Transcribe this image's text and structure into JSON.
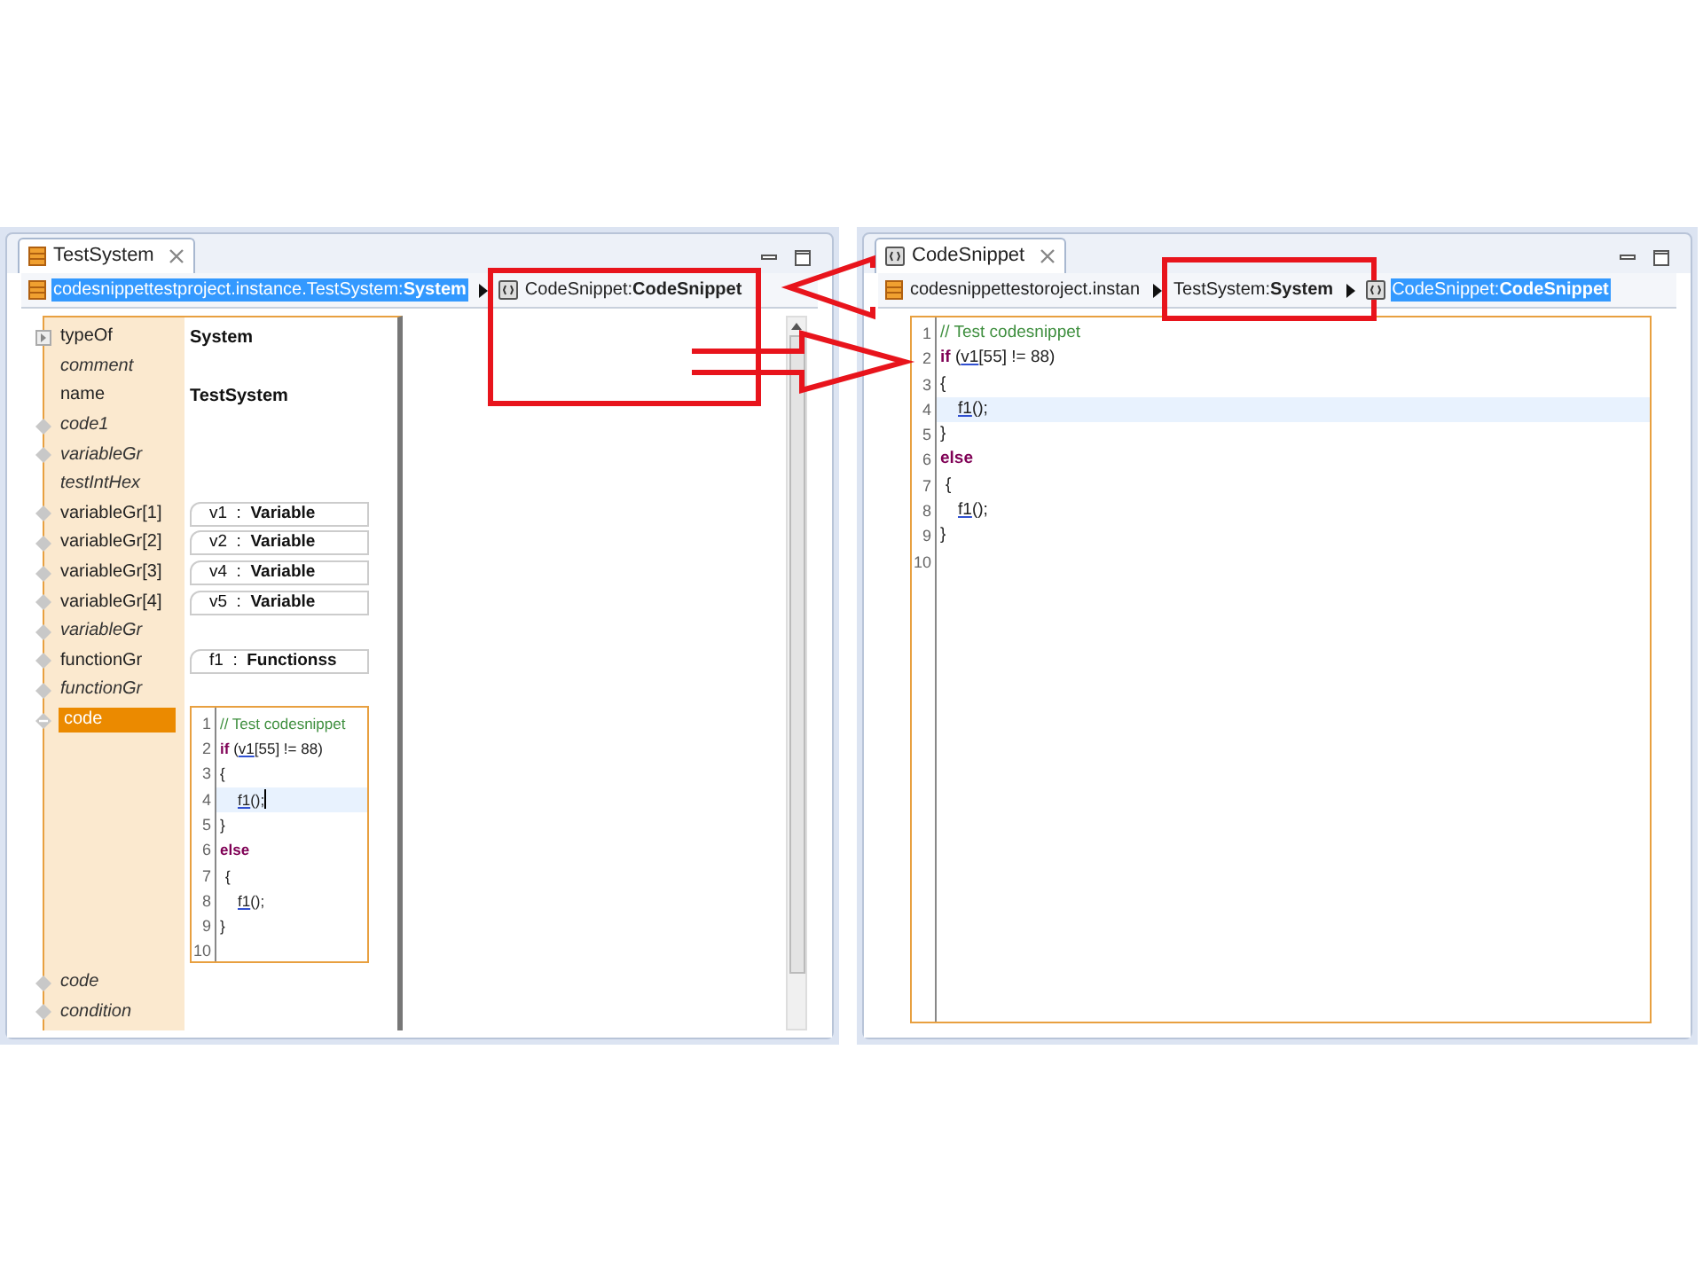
{
  "left_editor": {
    "tab": {
      "title": "TestSystem",
      "selected": true
    },
    "breadcrumb": [
      {
        "text": "codesnippettestproject.instance.TestSystem:",
        "bold": "System",
        "selected": true
      },
      {
        "text": "CodeSnippet:",
        "bold": "CodeSnippet",
        "selected": false
      }
    ],
    "properties": [
      {
        "label": "typeOf",
        "italic": false,
        "kind": "type",
        "value": "System",
        "selected": false
      },
      {
        "label": "comment",
        "italic": true,
        "kind": "attribute",
        "selected": false
      },
      {
        "label": "name",
        "italic": false,
        "kind": "attribute",
        "value": "TestSystem",
        "selected": false
      },
      {
        "label": "code1",
        "italic": true,
        "kind": "feature",
        "selected": false
      },
      {
        "label": "variableGr",
        "italic": true,
        "kind": "feature",
        "selected": false
      },
      {
        "label": "testIntHex",
        "italic": true,
        "kind": "attribute",
        "selected": false
      },
      {
        "label": "variableGr[1]",
        "italic": false,
        "kind": "reference",
        "value": "v1  :  **Variable**",
        "selected": false
      },
      {
        "label": "variableGr[2]",
        "italic": false,
        "kind": "reference",
        "value": "v2  :  **Variable**",
        "selected": false
      },
      {
        "label": "variableGr[3]",
        "italic": false,
        "kind": "reference",
        "value": "v4  :  **Variable**",
        "selected": false
      },
      {
        "label": "variableGr[4]",
        "italic": false,
        "kind": "reference",
        "value": "v5  :  **Variable**",
        "selected": false
      },
      {
        "label": "variableGr",
        "italic": true,
        "kind": "feature",
        "selected": false
      },
      {
        "label": "functionGr",
        "italic": false,
        "kind": "reference",
        "value": "f1  :  **Functionss**",
        "selected": false
      },
      {
        "label": "functionGr",
        "italic": true,
        "kind": "feature",
        "selected": false
      },
      {
        "label": "code",
        "italic": false,
        "kind": "code",
        "selected": true,
        "lines": [
          {
            "number": "1",
            "current": false,
            "kind": "flush",
            "segments": [
              {
                "kind": "comment",
                "text": "// Test codesnippet"
              }
            ]
          },
          {
            "number": "2",
            "current": false,
            "kind": "flush",
            "segments": [
              {
                "kind": "keyword",
                "text": "if"
              },
              {
                "kind": "plain",
                "text": " ("
              },
              {
                "kind": "ref",
                "text": "v1"
              },
              {
                "kind": "plain",
                "text": "[55] != 88)"
              }
            ]
          },
          {
            "number": "3",
            "current": false,
            "kind": "flush",
            "segments": [
              {
                "kind": "plain",
                "text": "{"
              }
            ]
          },
          {
            "number": "4",
            "current": true,
            "kind": "nested",
            "segments": [
              {
                "kind": "ref",
                "text": "f1"
              },
              {
                "kind": "plain",
                "text": "();"
              }
            ]
          },
          {
            "number": "5",
            "current": false,
            "kind": "flush",
            "segments": [
              {
                "kind": "plain",
                "text": "}"
              }
            ]
          },
          {
            "number": "6",
            "current": false,
            "kind": "flush",
            "segments": [
              {
                "kind": "keyword",
                "text": "else"
              }
            ]
          },
          {
            "number": "7",
            "current": false,
            "kind": "offset",
            "segments": [
              {
                "kind": "plain",
                "text": "{"
              }
            ]
          },
          {
            "number": "8",
            "current": false,
            "kind": "nested",
            "segments": [
              {
                "kind": "ref",
                "text": "f1"
              },
              {
                "kind": "plain",
                "text": "();"
              }
            ]
          },
          {
            "number": "9",
            "current": false,
            "kind": "flush",
            "segments": [
              {
                "kind": "plain",
                "text": "}"
              }
            ]
          },
          {
            "number": "10",
            "current": false,
            "kind": "flush"
          }
        ]
      },
      {
        "label": "code",
        "italic": true,
        "kind": "feature",
        "selected": false
      },
      {
        "label": "condition",
        "italic": true,
        "kind": "feature",
        "selected": false
      }
    ]
  },
  "right_editor": {
    "tab": {
      "title": "CodeSnippet",
      "selected": true
    },
    "breadcrumb": [
      {
        "text": "codesnippettestoroject.instan",
        "selected": false
      },
      {
        "text": "TestSystem:",
        "bold": "System",
        "selected": false
      },
      {
        "text": "CodeSnippet:",
        "bold": "CodeSnippet",
        "selected": true
      }
    ],
    "code": [
      {
        "number": "1",
        "current": false,
        "kind": "flush",
        "segments": [
          {
            "kind": "comment",
            "text": "// Test codesnippet"
          }
        ]
      },
      {
        "number": "2",
        "current": false,
        "kind": "flush",
        "segments": [
          {
            "kind": "keyword",
            "text": "if"
          },
          {
            "kind": "plain",
            "text": " ("
          },
          {
            "kind": "ref",
            "text": "v1"
          },
          {
            "kind": "plain",
            "text": "[55] != 88)"
          }
        ]
      },
      {
        "number": "3",
        "current": false,
        "kind": "flush",
        "segments": [
          {
            "kind": "plain",
            "text": "{"
          }
        ]
      },
      {
        "number": "4",
        "current": true,
        "kind": "nested",
        "segments": [
          {
            "kind": "ref",
            "text": "f1"
          },
          {
            "kind": "plain",
            "text": "();"
          }
        ]
      },
      {
        "number": "5",
        "current": false,
        "kind": "flush",
        "segments": [
          {
            "kind": "plain",
            "text": "}"
          }
        ]
      },
      {
        "number": "6",
        "current": false,
        "kind": "flush",
        "segments": [
          {
            "kind": "keyword",
            "text": "else"
          }
        ]
      },
      {
        "number": "7",
        "current": false,
        "kind": "offset",
        "segments": [
          {
            "kind": "plain",
            "text": "{"
          }
        ]
      },
      {
        "number": "8",
        "current": false,
        "kind": "nested",
        "segments": [
          {
            "kind": "ref",
            "text": "f1"
          },
          {
            "kind": "plain",
            "text": "();"
          }
        ]
      },
      {
        "number": "9",
        "current": false,
        "kind": "flush",
        "segments": [
          {
            "kind": "plain",
            "text": "}"
          }
        ]
      },
      {
        "number": "10",
        "current": false,
        "kind": "flush"
      }
    ]
  }
}
